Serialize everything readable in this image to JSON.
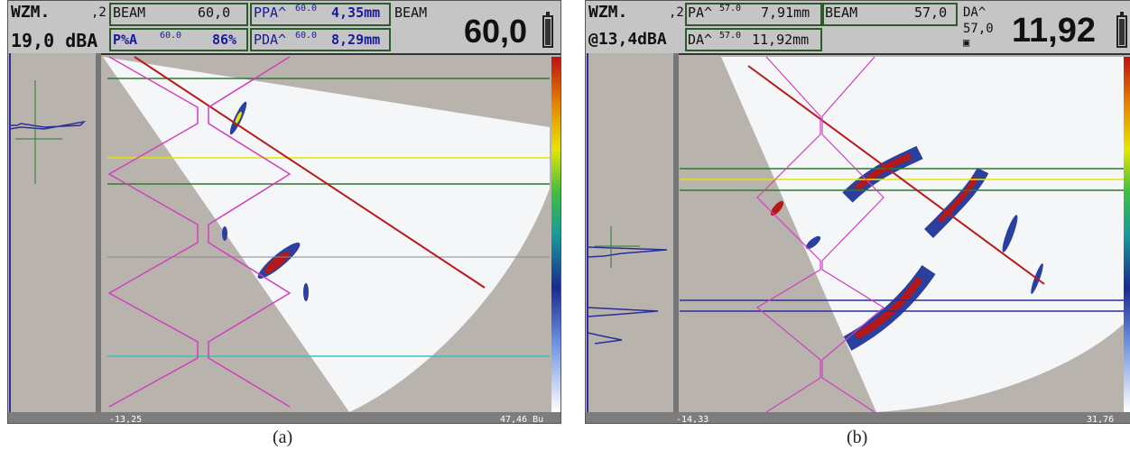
{
  "panels": [
    {
      "id": "a",
      "caption": "(a)",
      "header": {
        "mode": "WZM.",
        "gain_step": ",2",
        "gain": "19,0 dBA",
        "beam_label": "BEAM",
        "beam_value": "60,0",
        "pct_label": "P%A",
        "pct_angle": "60.0",
        "pct_value": "86%",
        "ppa_label": "PPA^",
        "ppa_angle": "60.0",
        "ppa_value": "4,35mm",
        "pda_label": "PDA^",
        "pda_angle": "60.0",
        "pda_value": "8,29mm",
        "right_label": "BEAM",
        "big_value": "60,0"
      },
      "axis": {
        "x_start": "-13,25",
        "x_end": "47,46 Bu"
      },
      "battery_level": 0.9
    },
    {
      "id": "b",
      "caption": "(b)",
      "header": {
        "mode": "WZM.",
        "gain_step": ",2",
        "gain": "@13,4dBA",
        "pa_label": "PA^",
        "pa_angle": "57.0",
        "pa_value": "7,91mm",
        "beam_label": "BEAM",
        "beam_value": "57,0",
        "da_label": "DA^",
        "da_angle": "57.0",
        "da_value": "11,92mm",
        "right_label": "DA^",
        "right_angle": "57,0",
        "big_value": "11,92"
      },
      "axis": {
        "x_start": "-14,33",
        "x_end": "31,76"
      },
      "battery_level": 0.9
    }
  ],
  "colors": {
    "screen_bg": "#b8b3ad",
    "header_bg": "#c5c5c5",
    "scan_white": "#f4f6f8",
    "echo_blue": "#2a3f9e",
    "echo_red": "#b51818",
    "cursor_magenta": "#d23fbf",
    "cursor_red": "#b81a1a",
    "cursor_green": "#2e7a2e",
    "cursor_yellow": "#e6e600",
    "cursor_cyan": "#3fbfbf",
    "cursor_blue": "#2d2d9a"
  },
  "icons": [
    "battery-icon",
    "save-disk-icon"
  ]
}
